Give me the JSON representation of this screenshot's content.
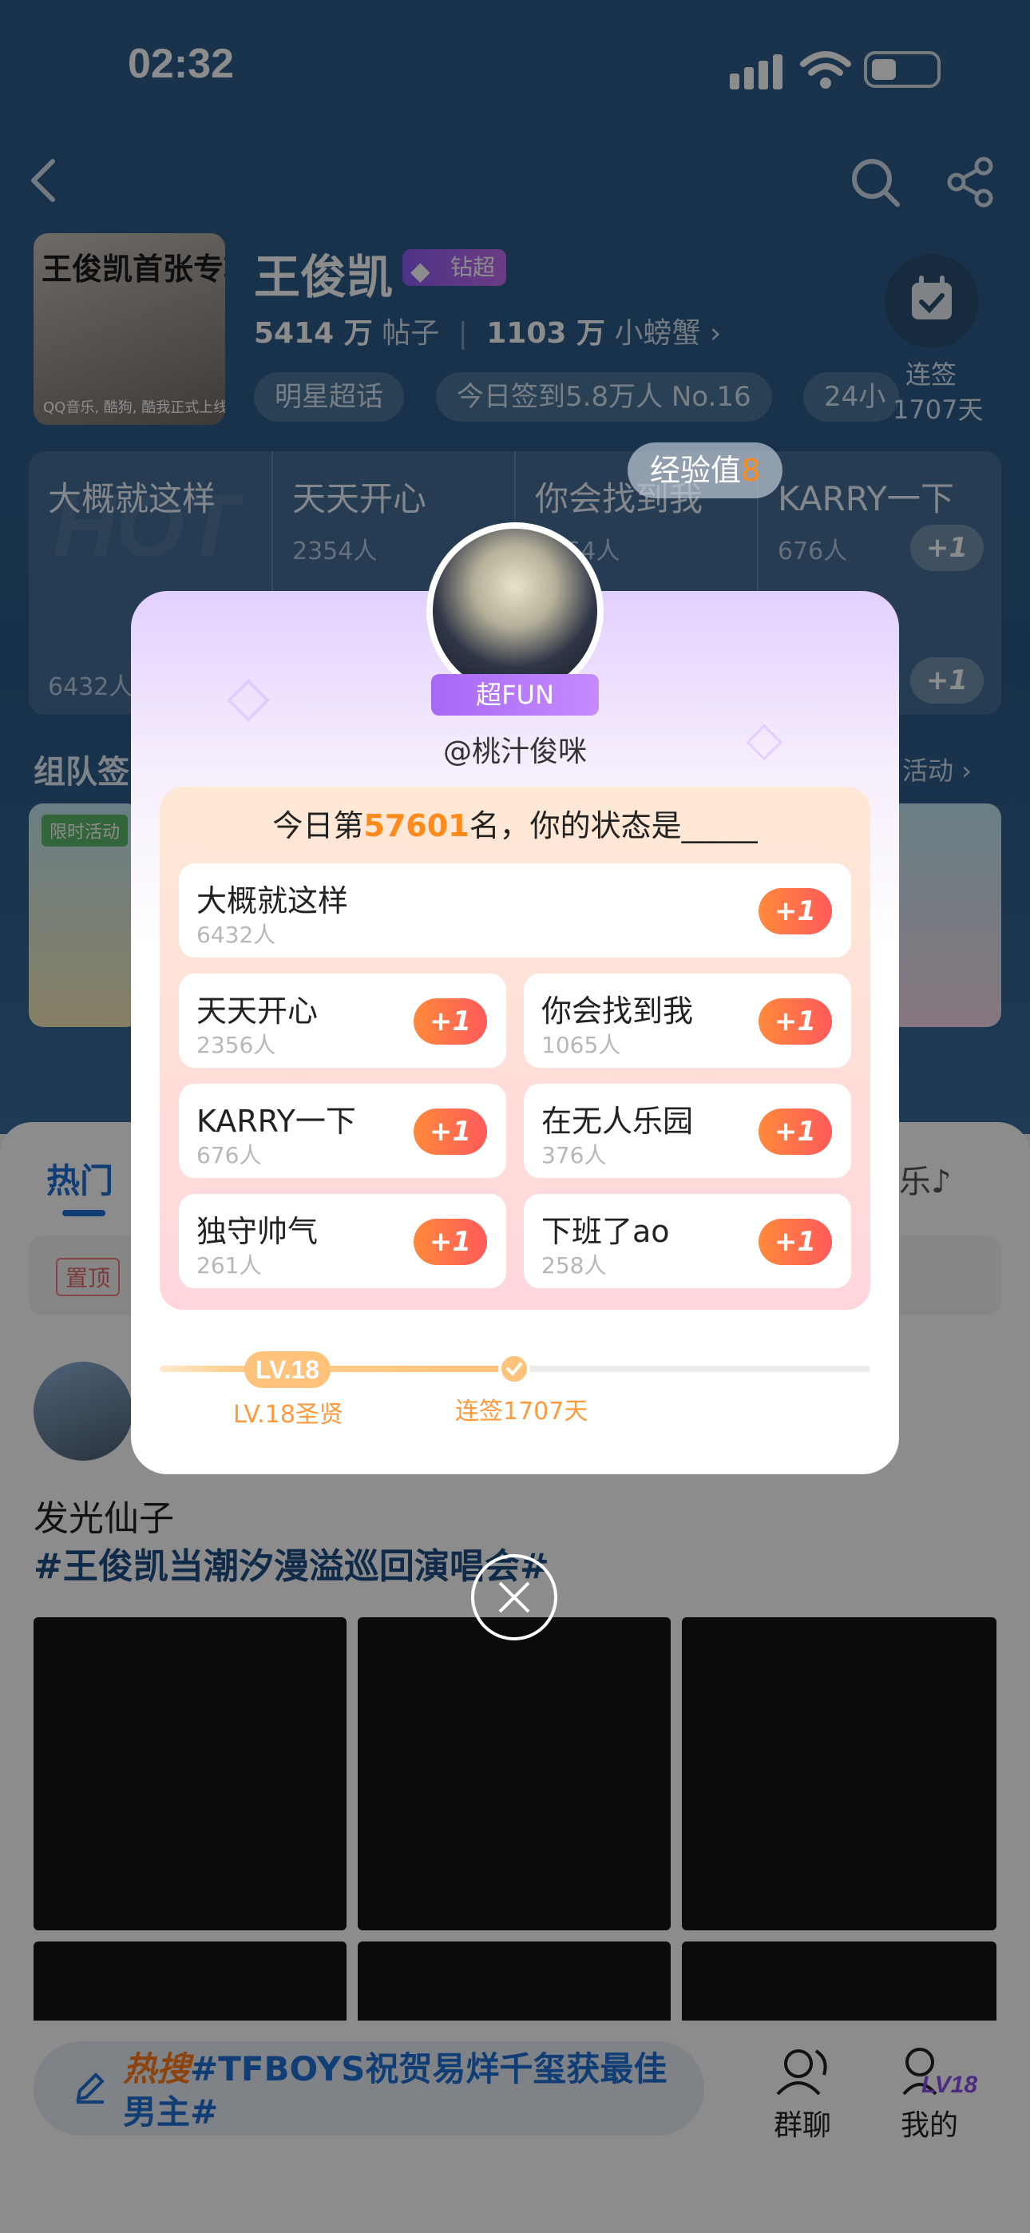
{
  "status_bar": {
    "time": "02:32"
  },
  "header": {
    "title": "王俊凯",
    "badge": "钻超",
    "posts_count": "5414 万",
    "posts_label": "帖子",
    "fans_count": "1103 万",
    "fans_label": "小螃蟹",
    "tags": [
      "明星超话",
      "今日签到5.8万人 No.16",
      "24小"
    ],
    "checkin_label": "连签",
    "checkin_days": "1707天",
    "album_line1": "王俊凯首张专辑",
    "album_line2": "QQ音乐, 酷狗, 酷我正式上线"
  },
  "background_vote": {
    "hot": "HOT",
    "items": [
      {
        "name": "大概就这样",
        "count": "6432人"
      },
      {
        "name": "天天开心",
        "count": "2354人"
      },
      {
        "name": "你会找到我",
        "count": "1064人"
      },
      {
        "name": "KARRY一下",
        "count": "676人"
      }
    ],
    "plus": "+1"
  },
  "team_section": {
    "title": "组队签",
    "more": "活动 ›",
    "limited": "限时活动"
  },
  "feed": {
    "tabs": [
      "热门",
      "乐♪"
    ],
    "pinned": "置顶",
    "post_title": "发光仙子",
    "post_hashtag": "#王俊凯当潮汐漫溢巡回演唱会#"
  },
  "bottom_bar": {
    "hot_label": "热搜",
    "hot_text": "#TFBOYS祝贺易烊千玺获最佳男主#",
    "group_chat": "群聊",
    "mine": "我的",
    "level_badge": "LV18"
  },
  "popup": {
    "exp_label": "经验值",
    "exp_value": "8",
    "badge": "超FUN",
    "username": "@桃汁俊咪",
    "rank_prefix": "今日第",
    "rank_number": "57601",
    "rank_suffix": "名，你的状态是_____",
    "options": [
      {
        "name": "大概就这样",
        "count": "6432人"
      },
      {
        "name": "天天开心",
        "count": "2356人"
      },
      {
        "name": "你会找到我",
        "count": "1065人"
      },
      {
        "name": "KARRY一下",
        "count": "676人"
      },
      {
        "name": "在无人乐园",
        "count": "376人"
      },
      {
        "name": "独守帅气",
        "count": "261人"
      },
      {
        "name": "下班了ao",
        "count": "258人"
      }
    ],
    "plus_label": "+1",
    "level_pill": "LV.18",
    "level_label": "LV.18圣贤",
    "streak_label": "连签1707天",
    "accent_color": "#ff8a1c",
    "purple_color": "#b57bff"
  }
}
